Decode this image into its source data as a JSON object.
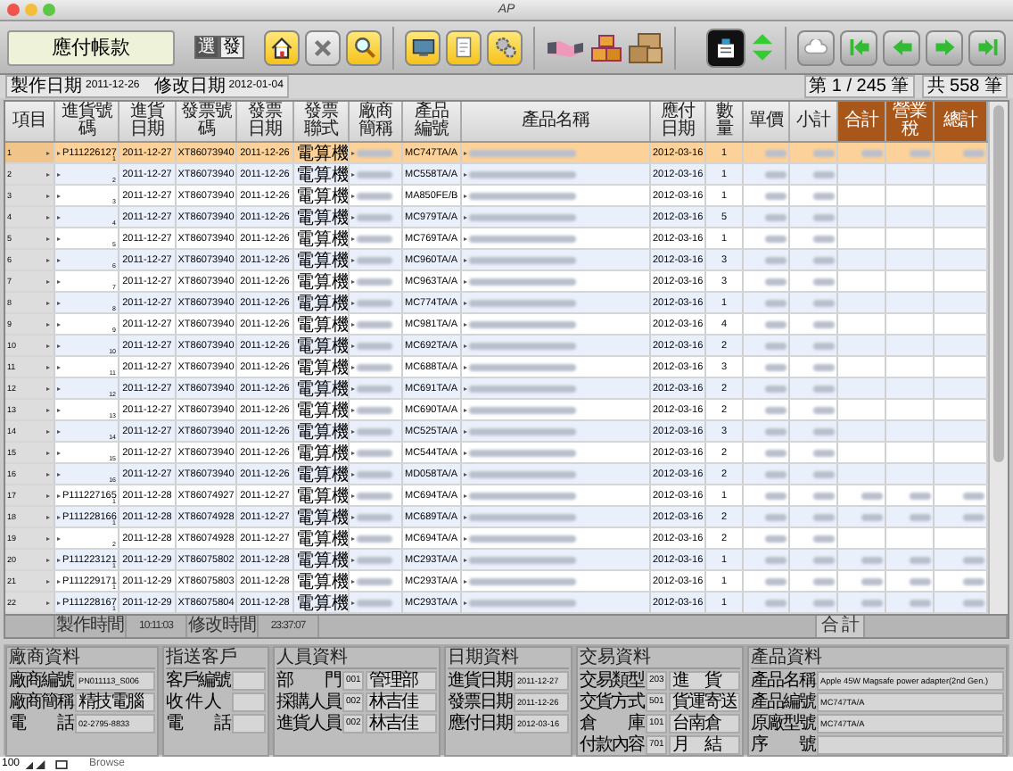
{
  "window": {
    "title": "AP"
  },
  "toolbar": {
    "title": "應付帳款",
    "toggle": [
      {
        "label": "選",
        "selected": true
      },
      {
        "label": "發",
        "selected": false
      }
    ]
  },
  "record_info": {
    "created_label": "製作日期",
    "created": "2011-12-26",
    "modified_label": "修改日期",
    "modified": "2012-01-04",
    "position": "第 1 / 245 筆",
    "total": "共 558 筆"
  },
  "table": {
    "columns": [
      {
        "label": "項目",
        "kind": "normal"
      },
      {
        "label": "進貨號碼",
        "kind": "normal"
      },
      {
        "label": "進貨日期",
        "kind": "normal"
      },
      {
        "label": "發票號碼",
        "kind": "normal"
      },
      {
        "label": "發票日期",
        "kind": "normal"
      },
      {
        "label": "發票聯式",
        "kind": "normal"
      },
      {
        "label": "廠商簡稱",
        "kind": "normal"
      },
      {
        "label": "產品編號",
        "kind": "normal"
      },
      {
        "label": "產品名稱",
        "kind": "normal"
      },
      {
        "label": "應付日期",
        "kind": "normal"
      },
      {
        "label": "數量",
        "kind": "normal"
      },
      {
        "label": "單價",
        "kind": "normal"
      },
      {
        "label": "小計",
        "kind": "normal"
      },
      {
        "label": "合計",
        "kind": "total"
      },
      {
        "label": "營業稅",
        "kind": "total"
      },
      {
        "label": "總計",
        "kind": "total"
      }
    ],
    "rows": [
      {
        "no": "1",
        "order": "P111226127",
        "line": "1",
        "date": "2011-12-27",
        "invoice": "XT86073940",
        "invoice_date": "2011-12-26",
        "invoice_type": "電算機",
        "product_code": "MC747TA/A",
        "due": "2012-03-16",
        "qty": "1",
        "has_totals": true,
        "selected": true
      },
      {
        "no": "2",
        "line": "2",
        "date": "2011-12-27",
        "invoice": "XT86073940",
        "invoice_date": "2011-12-26",
        "invoice_type": "電算機",
        "product_code": "MC558TA/A",
        "due": "2012-03-16",
        "qty": "1",
        "has_totals": false,
        "selected": false
      },
      {
        "no": "3",
        "line": "3",
        "date": "2011-12-27",
        "invoice": "XT86073940",
        "invoice_date": "2011-12-26",
        "invoice_type": "電算機",
        "product_code": "MA850FE/B",
        "due": "2012-03-16",
        "qty": "1",
        "has_totals": false,
        "selected": false
      },
      {
        "no": "4",
        "line": "4",
        "date": "2011-12-27",
        "invoice": "XT86073940",
        "invoice_date": "2011-12-26",
        "invoice_type": "電算機",
        "product_code": "MC979TA/A",
        "due": "2012-03-16",
        "qty": "5",
        "has_totals": false,
        "selected": false
      },
      {
        "no": "5",
        "line": "5",
        "date": "2011-12-27",
        "invoice": "XT86073940",
        "invoice_date": "2011-12-26",
        "invoice_type": "電算機",
        "product_code": "MC769TA/A",
        "due": "2012-03-16",
        "qty": "1",
        "has_totals": false,
        "selected": false
      },
      {
        "no": "6",
        "line": "6",
        "date": "2011-12-27",
        "invoice": "XT86073940",
        "invoice_date": "2011-12-26",
        "invoice_type": "電算機",
        "product_code": "MC960TA/A",
        "due": "2012-03-16",
        "qty": "3",
        "has_totals": false,
        "selected": false
      },
      {
        "no": "7",
        "line": "7",
        "date": "2011-12-27",
        "invoice": "XT86073940",
        "invoice_date": "2011-12-26",
        "invoice_type": "電算機",
        "product_code": "MC963TA/A",
        "due": "2012-03-16",
        "qty": "3",
        "has_totals": false,
        "selected": false
      },
      {
        "no": "8",
        "line": "8",
        "date": "2011-12-27",
        "invoice": "XT86073940",
        "invoice_date": "2011-12-26",
        "invoice_type": "電算機",
        "product_code": "MC774TA/A",
        "due": "2012-03-16",
        "qty": "1",
        "has_totals": false,
        "selected": false
      },
      {
        "no": "9",
        "line": "9",
        "date": "2011-12-27",
        "invoice": "XT86073940",
        "invoice_date": "2011-12-26",
        "invoice_type": "電算機",
        "product_code": "MC981TA/A",
        "due": "2012-03-16",
        "qty": "4",
        "has_totals": false,
        "selected": false
      },
      {
        "no": "10",
        "line": "10",
        "date": "2011-12-27",
        "invoice": "XT86073940",
        "invoice_date": "2011-12-26",
        "invoice_type": "電算機",
        "product_code": "MC692TA/A",
        "due": "2012-03-16",
        "qty": "2",
        "has_totals": false,
        "selected": false
      },
      {
        "no": "11",
        "line": "11",
        "date": "2011-12-27",
        "invoice": "XT86073940",
        "invoice_date": "2011-12-26",
        "invoice_type": "電算機",
        "product_code": "MC688TA/A",
        "due": "2012-03-16",
        "qty": "3",
        "has_totals": false,
        "selected": false
      },
      {
        "no": "12",
        "line": "12",
        "date": "2011-12-27",
        "invoice": "XT86073940",
        "invoice_date": "2011-12-26",
        "invoice_type": "電算機",
        "product_code": "MC691TA/A",
        "due": "2012-03-16",
        "qty": "2",
        "has_totals": false,
        "selected": false
      },
      {
        "no": "13",
        "line": "13",
        "date": "2011-12-27",
        "invoice": "XT86073940",
        "invoice_date": "2011-12-26",
        "invoice_type": "電算機",
        "product_code": "MC690TA/A",
        "due": "2012-03-16",
        "qty": "2",
        "has_totals": false,
        "selected": false
      },
      {
        "no": "14",
        "line": "14",
        "date": "2011-12-27",
        "invoice": "XT86073940",
        "invoice_date": "2011-12-26",
        "invoice_type": "電算機",
        "product_code": "MC525TA/A",
        "due": "2012-03-16",
        "qty": "3",
        "has_totals": false,
        "selected": false
      },
      {
        "no": "15",
        "line": "15",
        "date": "2011-12-27",
        "invoice": "XT86073940",
        "invoice_date": "2011-12-26",
        "invoice_type": "電算機",
        "product_code": "MC544TA/A",
        "due": "2012-03-16",
        "qty": "2",
        "has_totals": false,
        "selected": false
      },
      {
        "no": "16",
        "line": "16",
        "date": "2011-12-27",
        "invoice": "XT86073940",
        "invoice_date": "2011-12-26",
        "invoice_type": "電算機",
        "product_code": "MD058TA/A",
        "due": "2012-03-16",
        "qty": "2",
        "has_totals": false,
        "selected": false
      },
      {
        "no": "17",
        "order": "P111227165",
        "line": "1",
        "date": "2011-12-28",
        "invoice": "XT86074927",
        "invoice_date": "2011-12-27",
        "invoice_type": "電算機",
        "product_code": "MC694TA/A",
        "due": "2012-03-16",
        "qty": "1",
        "has_totals": true,
        "selected": false
      },
      {
        "no": "18",
        "order": "P111228166",
        "line": "1",
        "date": "2011-12-28",
        "invoice": "XT86074928",
        "invoice_date": "2011-12-27",
        "invoice_type": "電算機",
        "product_code": "MC689TA/A",
        "due": "2012-03-16",
        "qty": "2",
        "has_totals": true,
        "selected": false
      },
      {
        "no": "19",
        "line": "2",
        "date": "2011-12-28",
        "invoice": "XT86074928",
        "invoice_date": "2011-12-27",
        "invoice_type": "電算機",
        "product_code": "MC694TA/A",
        "due": "2012-03-16",
        "qty": "2",
        "has_totals": false,
        "selected": false
      },
      {
        "no": "20",
        "order": "P111223121",
        "line": "1",
        "date": "2011-12-29",
        "invoice": "XT86075802",
        "invoice_date": "2011-12-28",
        "invoice_type": "電算機",
        "product_code": "MC293TA/A",
        "due": "2012-03-16",
        "qty": "1",
        "has_totals": true,
        "selected": false
      },
      {
        "no": "21",
        "order": "P111229171",
        "line": "1",
        "date": "2011-12-29",
        "invoice": "XT86075803",
        "invoice_date": "2011-12-28",
        "invoice_type": "電算機",
        "product_code": "MC293TA/A",
        "due": "2012-03-16",
        "qty": "1",
        "has_totals": true,
        "selected": false
      },
      {
        "no": "22",
        "order": "P111228167",
        "line": "1",
        "date": "2011-12-29",
        "invoice": "XT86075804",
        "invoice_date": "2011-12-28",
        "invoice_type": "電算機",
        "product_code": "MC293TA/A",
        "due": "2012-03-16",
        "qty": "1",
        "has_totals": true,
        "selected": false
      }
    ],
    "footer": {
      "created_label": "製作時間",
      "created_time": "10:11:03",
      "modified_label": "修改時間",
      "modified_time": "23:37:07",
      "total_label": "合 計"
    }
  },
  "panels": [
    {
      "title": "廠商資料",
      "fields": [
        {
          "label": "廠商編號",
          "value": "PN011113_S006"
        },
        {
          "label": "廠商簡稱",
          "value": "精技電腦"
        },
        {
          "label": "電　　話",
          "value": "02-2795-8833"
        }
      ]
    },
    {
      "title": "指送客戶",
      "fields": [
        {
          "label": "客戶編號"
        },
        {
          "label": "收 件 人"
        },
        {
          "label": "電　　話"
        }
      ]
    },
    {
      "title": "人員資料",
      "fields": [
        {
          "label": "部　　門",
          "code": "001",
          "value": "管理部"
        },
        {
          "label": "採購人員",
          "code": "002",
          "value": "林吉佳"
        },
        {
          "label": "進貨人員",
          "code": "002",
          "value": "林吉佳"
        }
      ]
    },
    {
      "title": "日期資料",
      "fields": [
        {
          "label": "進貨日期",
          "value": "2011-12-27"
        },
        {
          "label": "發票日期",
          "value": "2011-12-26"
        },
        {
          "label": "應付日期",
          "value": "2012-03-16"
        }
      ]
    },
    {
      "title": "交易資料",
      "fields": [
        {
          "label": "交易類型",
          "code": "203",
          "value": "進　貨"
        },
        {
          "label": "交貨方式",
          "code": "501",
          "value": "貨運寄送"
        },
        {
          "label": "倉　　庫",
          "code": "101",
          "value": "台南倉"
        },
        {
          "label": "付款內容",
          "code": "701",
          "value": "月　結"
        }
      ]
    },
    {
      "title": "產品資料",
      "fields": [
        {
          "label": "產品名稱",
          "value": "Apple 45W Magsafe power adapter(2nd Gen.)"
        },
        {
          "label": "產品編號",
          "value": "MC747TA/A"
        },
        {
          "label": "原廠型號",
          "value": "MC747TA/A"
        },
        {
          "label": "序　　號"
        }
      ]
    }
  ],
  "status_bar": {
    "zoom": "100",
    "mode": "Browse"
  }
}
